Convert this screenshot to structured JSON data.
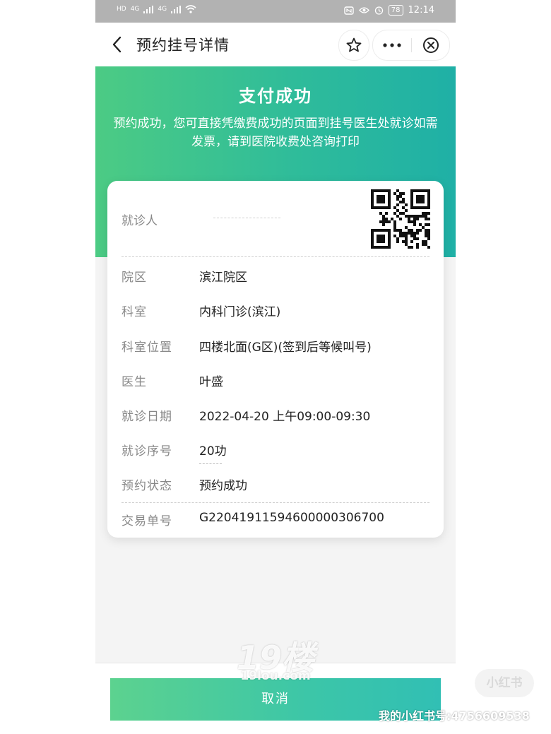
{
  "status_bar": {
    "left_indicators": [
      "HD",
      "4G",
      "4G"
    ],
    "battery": "78",
    "time": "12:14"
  },
  "nav": {
    "title": "预约挂号详情"
  },
  "banner": {
    "title": "支付成功",
    "description": "预约成功，您可直接凭缴费成功的页面到挂号医生处就诊如需发票，请到医院收费处咨询打印"
  },
  "card": {
    "patient_label": "就诊人",
    "rows": [
      {
        "label": "院区",
        "value": "滨江院区"
      },
      {
        "label": "科室",
        "value": "内科门诊(滨江)"
      },
      {
        "label": "科室位置",
        "value": "四楼北面(G区)(签到后等候叫号)"
      },
      {
        "label": "医生",
        "value": "叶盛"
      },
      {
        "label": "就诊日期",
        "value": "2022-04-20 上午09:00-09:30"
      },
      {
        "label": "就诊序号",
        "value": "20功"
      },
      {
        "label": "预约状态",
        "value": "预约成功"
      },
      {
        "label": "交易单号",
        "value": "G22041911594600000306700"
      }
    ]
  },
  "bottom": {
    "cancel_label": "取消"
  },
  "watermarks": {
    "site_logo": "19楼",
    "site_domain": "19lou.com",
    "xhs_logo": "小红书",
    "xhs_id": "我的小红书号:4756609538"
  },
  "colors": {
    "banner_start": "#4ccb84",
    "banner_end": "#1fb0a6",
    "button_start": "#5cd28f",
    "button_end": "#31bfb4"
  },
  "icons": [
    "back-arrow-icon",
    "star-icon",
    "more-dots-icon",
    "close-circle-icon",
    "qr-code-icon",
    "signal-icon",
    "wifi-icon",
    "nfc-icon",
    "eye-icon",
    "alarm-icon"
  ]
}
